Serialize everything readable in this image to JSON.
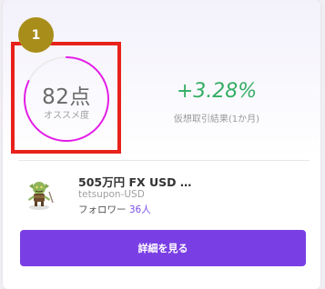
{
  "card": {
    "rank": "1",
    "score": {
      "value": "82点",
      "label": "オススメ度",
      "percent": 82
    },
    "performance": {
      "value": "+3.28%",
      "label": "仮想取引結果(1か月)"
    },
    "trader": {
      "name": "505万円 FX USD …",
      "id": "tetsupon-USD",
      "followers_label": "フォロワー",
      "followers_count": "36人"
    },
    "detail_button_label": "詳細を見る"
  },
  "colors": {
    "rank_badge": "#a88d1a",
    "score_ring": "#e41ee8",
    "highlight_box": "#e8221b",
    "performance_positive": "#34ad64",
    "accent": "#7a3fe4"
  }
}
